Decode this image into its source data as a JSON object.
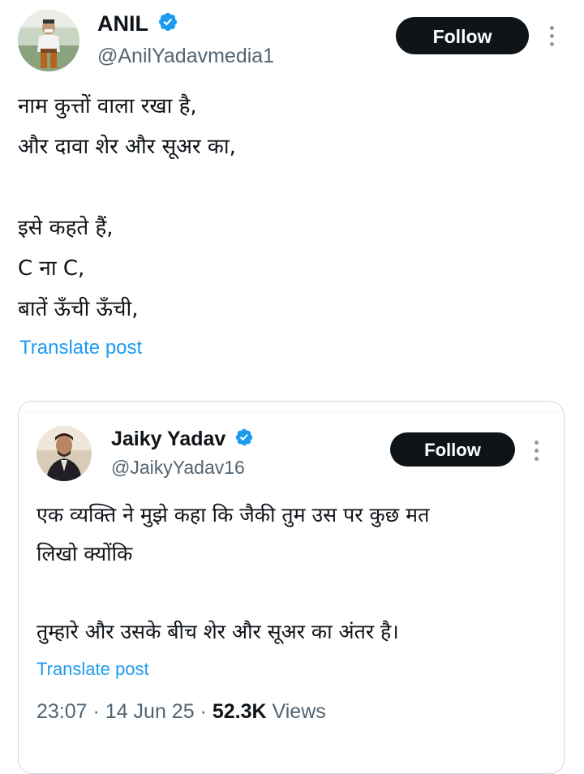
{
  "post": {
    "author": {
      "display_name": "ANIL",
      "handle": "@AnilYadavmedia1",
      "verified": true,
      "avatar": "person-avatar"
    },
    "follow_label": "Follow",
    "more_icon": "more-vertical-icon",
    "text_lines": [
      "नाम कुत्तों वाला रखा है,",
      "और दावा शेर और सूअर का,",
      "",
      "इसे कहते हैं,",
      "C ना C,",
      "बातें ऊँची ऊँची,"
    ],
    "translate_label": "Translate post"
  },
  "quoted_post": {
    "author": {
      "display_name": "Jaiky Yadav",
      "handle": "@JaikyYadav16",
      "verified": true,
      "avatar": "person-avatar"
    },
    "follow_label": "Follow",
    "more_icon": "more-vertical-icon",
    "text_lines": [
      "एक व्यक्ति ने मुझे कहा कि जैकी तुम उस पर कुछ मत",
      "लिखो क्योंकि",
      "",
      "तुम्हारे और उसके बीच शेर और सूअर का अंतर है।"
    ],
    "translate_label": "Translate post",
    "meta": {
      "time": "23:07",
      "separator": "·",
      "date": "14 Jun 25",
      "views_count": "52.3K",
      "views_label": "Views"
    }
  },
  "colors": {
    "text_primary": "#0f1419",
    "text_secondary": "#536471",
    "link": "#1d9bf0",
    "verified_badge": "#1d9bf0",
    "button_bg": "#0f1419",
    "button_text": "#ffffff",
    "border": "#cfd9de"
  }
}
